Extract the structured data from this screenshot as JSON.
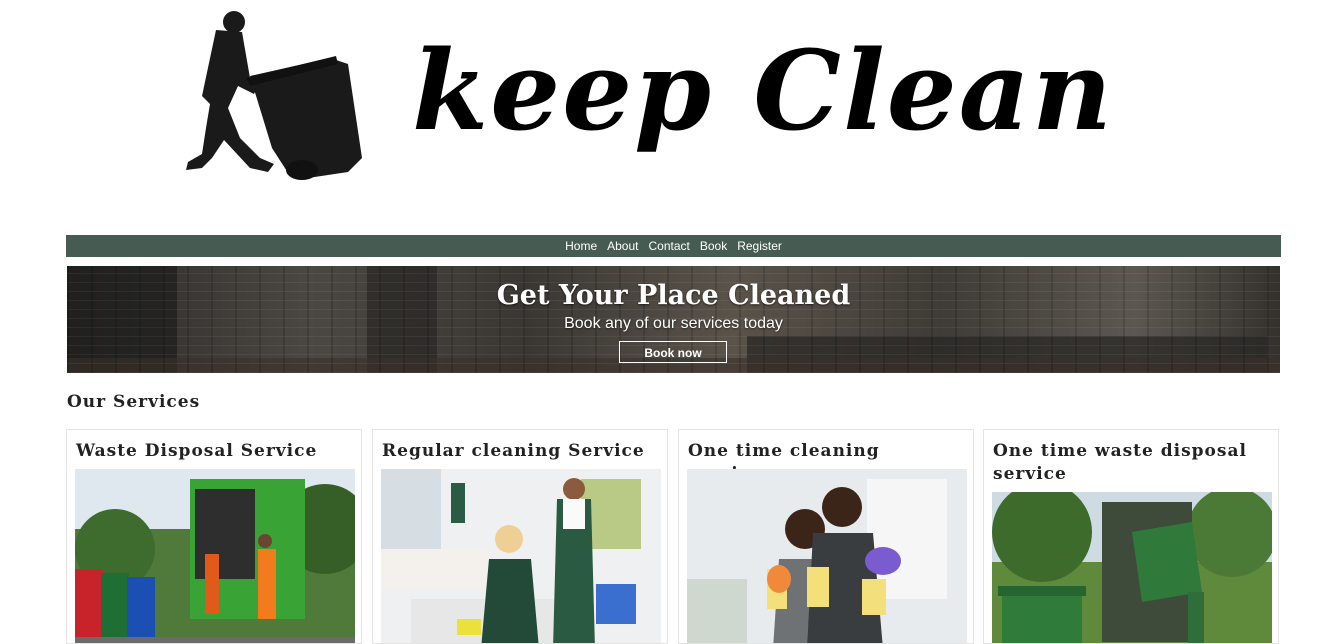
{
  "brand": {
    "logo_text": "keep Clean"
  },
  "nav": {
    "items": [
      "Home",
      "About",
      "Contact",
      "Book",
      "Register"
    ]
  },
  "hero": {
    "title": "Get Your Place Cleaned",
    "subtitle": "Book any of our services today",
    "button_label": "Book now"
  },
  "services": {
    "heading": "Our Services",
    "cards": [
      {
        "title": "Waste Disposal Service"
      },
      {
        "title": "Regular cleaning Service"
      },
      {
        "title": "One time cleaning service"
      },
      {
        "title": "One time waste disposal service"
      }
    ]
  },
  "colors": {
    "nav_bg": "#465c52",
    "nav_text": "#ffffff",
    "text": "#222222"
  }
}
